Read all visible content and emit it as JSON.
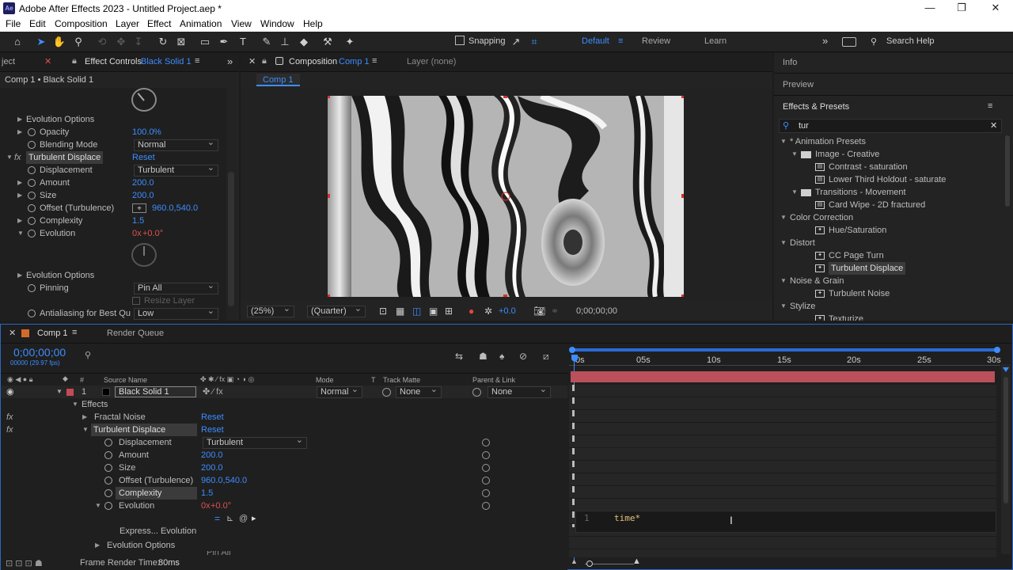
{
  "app": {
    "title": "Adobe After Effects 2023 - Untitled Project.aep *",
    "icon": "Ae"
  },
  "menu": [
    "File",
    "Edit",
    "Composition",
    "Layer",
    "Effect",
    "Animation",
    "View",
    "Window",
    "Help"
  ],
  "toolbar": {
    "snapping": "Snapping",
    "workspaces": [
      "Default",
      "Review",
      "Learn"
    ],
    "search_help": "Search Help"
  },
  "effect_controls": {
    "tab_project": "ject",
    "tab_label": "Effect Controls",
    "tab_layer": "Black Solid 1",
    "breadcrumb": "Comp 1 • Black Solid 1",
    "rows": {
      "evo_opts1": "Evolution Options",
      "opacity": "Opacity",
      "opacity_val": "100.0",
      "opacity_unit": "%",
      "blending": "Blending Mode",
      "blending_val": "Normal",
      "td": "Turbulent Displace",
      "td_reset": "Reset",
      "displacement": "Displacement",
      "displacement_val": "Turbulent",
      "amount": "Amount",
      "amount_val": "200.0",
      "size": "Size",
      "size_val": "200.0",
      "offset": "Offset (Turbulence)",
      "offset_val": "960.0,540.0",
      "complexity": "Complexity",
      "complexity_val": "1.5",
      "evolution": "Evolution",
      "evolution_val_x": "0x",
      "evolution_val_deg": "+0.0°",
      "evo_opts2": "Evolution Options",
      "pinning": "Pinning",
      "pinning_val": "Pin All",
      "resize": "Resize Layer",
      "antialias": "Antialiasing for Best Qu",
      "antialias_val": "Low"
    }
  },
  "composition": {
    "tab_label": "Composition",
    "tab_comp": "Comp 1",
    "layer_tab": "Layer (none)",
    "comp_chip": "Comp 1",
    "zoom": "(25%)",
    "quality": "(Quarter)",
    "exposure": "+0.0",
    "timecode": "0;00;00;00"
  },
  "right_panels": {
    "info": "Info",
    "preview": "Preview",
    "effects_presets": "Effects & Presets",
    "search_value": "tur",
    "tree": [
      {
        "label": "* Animation Presets",
        "indent": 0,
        "kind": "category"
      },
      {
        "label": "Image - Creative",
        "indent": 1,
        "kind": "folder"
      },
      {
        "label": "Contrast - saturation",
        "indent": 2,
        "kind": "preset"
      },
      {
        "label": "Lower Third Holdout - saturate",
        "indent": 2,
        "kind": "preset"
      },
      {
        "label": "Transitions - Movement",
        "indent": 1,
        "kind": "folder"
      },
      {
        "label": "Card Wipe - 2D fractured",
        "indent": 2,
        "kind": "preset"
      },
      {
        "label": "Color Correction",
        "indent": 0,
        "kind": "category"
      },
      {
        "label": "Hue/Saturation",
        "indent": 2,
        "kind": "effect"
      },
      {
        "label": "Distort",
        "indent": 0,
        "kind": "category"
      },
      {
        "label": "CC Page Turn",
        "indent": 2,
        "kind": "effect"
      },
      {
        "label": "Turbulent Displace",
        "indent": 2,
        "kind": "effect",
        "selected": true
      },
      {
        "label": "Noise & Grain",
        "indent": 0,
        "kind": "category"
      },
      {
        "label": "Turbulent Noise",
        "indent": 2,
        "kind": "effect"
      },
      {
        "label": "Stylize",
        "indent": 0,
        "kind": "category"
      },
      {
        "label": "Texturize",
        "indent": 2,
        "kind": "effect"
      }
    ]
  },
  "timeline": {
    "tab_comp": "Comp 1",
    "tab_render": "Render Queue",
    "timecode": "0;00;00;00",
    "fps": "00000 (29.97 fps)",
    "columns": {
      "hash": "#",
      "source": "Source Name",
      "mode": "Mode",
      "t": "T",
      "matte": "Track Matte",
      "parent": "Parent & Link"
    },
    "layer": {
      "num": "1",
      "name": "Black Solid 1",
      "mode": "Normal",
      "matte": "None",
      "parent": "None"
    },
    "rows": {
      "effects": "Effects",
      "fractal": "Fractal Noise",
      "fractal_reset": "Reset",
      "td": "Turbulent Displace",
      "td_reset": "Reset",
      "displacement": "Displacement",
      "displacement_val": "Turbulent",
      "amount": "Amount",
      "amount_val": "200.0",
      "size": "Size",
      "size_val": "200.0",
      "offset": "Offset (Turbulence)",
      "offset_val": "960.0,540.0",
      "complexity": "Complexity",
      "complexity_val": "1.5",
      "evolution": "Evolution",
      "evolution_val_x": "0x",
      "evolution_val_deg": "+0.0°",
      "express": "Express... Evolution",
      "evo_opts": "Evolution Options",
      "pin_partial": "Pin All"
    },
    "ruler": [
      "0s",
      "05s",
      "10s",
      "15s",
      "20s",
      "25s",
      "30s"
    ],
    "expression_line": "1",
    "expression": "time*",
    "frame_render_label": "Frame Render Time:",
    "frame_render_val": "80ms"
  },
  "colors": {
    "accent": "#3d8dff",
    "layer_bar": "#b9505a",
    "keyframe_red": "#e05050"
  }
}
